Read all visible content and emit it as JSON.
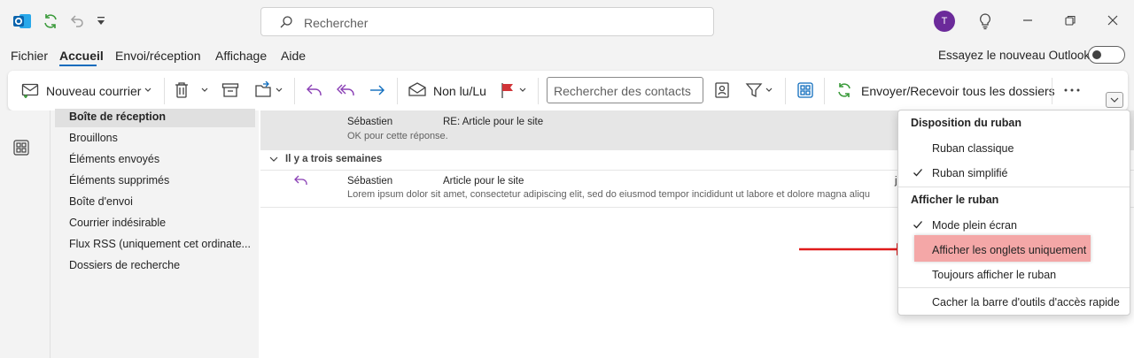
{
  "titlebar": {
    "search_placeholder": "Rechercher",
    "avatar_initial": "T"
  },
  "menu": {
    "tabs": [
      {
        "label": "Fichier"
      },
      {
        "label": "Accueil"
      },
      {
        "label": "Envoi/réception"
      },
      {
        "label": "Affichage"
      },
      {
        "label": "Aide"
      }
    ],
    "active_tab": "Accueil",
    "try_new_outlook": "Essayez le nouveau Outlook",
    "try_new_enabled": false
  },
  "ribbon": {
    "new_mail": "Nouveau courrier",
    "unread_read": "Non lu/Lu",
    "contact_search_placeholder": "Rechercher des contacts",
    "send_receive": "Envoyer/Recevoir tous les dossiers"
  },
  "folders": [
    {
      "label": "Boîte de réception",
      "selected": true
    },
    {
      "label": "Brouillons"
    },
    {
      "label": "Éléments envoyés"
    },
    {
      "label": "Éléments supprimés"
    },
    {
      "label": "Boîte d'envoi"
    },
    {
      "label": "Courrier indésirable"
    },
    {
      "label": "Flux RSS (uniquement cet ordinate..."
    },
    {
      "label": "Dossiers de recherche"
    }
  ],
  "messages": {
    "top": {
      "sender": "Sébastien",
      "subject": "RE: Article pour le site",
      "preview": "OK pour cette réponse."
    },
    "group_header": "Il y a trois semaines",
    "item": {
      "sender": "Sébastien",
      "subject": "Article pour le site",
      "preview": "Lorem ipsum dolor sit amet, consectetur adipiscing elit, sed do eiusmod tempor incididunt ut labore et dolore magna aliqu",
      "date_fragment": "j"
    }
  },
  "dropdown": {
    "section1_title": "Disposition du ruban",
    "classic": "Ruban classique",
    "simplified": "Ruban simplifié",
    "section2_title": "Afficher le ruban",
    "fullscreen": "Mode plein écran",
    "tabs_only": "Afficher les onglets uniquement",
    "always_show": "Toujours afficher le ruban",
    "hide_qat": "Cacher la barre d'outils d'accès rapide"
  },
  "colors": {
    "accent": "#0f6cbd",
    "avatar": "#6b2a9a",
    "highlight": "#f4a7a7",
    "arrow": "#e01b1b",
    "reply_purple": "#8a3fb5"
  }
}
